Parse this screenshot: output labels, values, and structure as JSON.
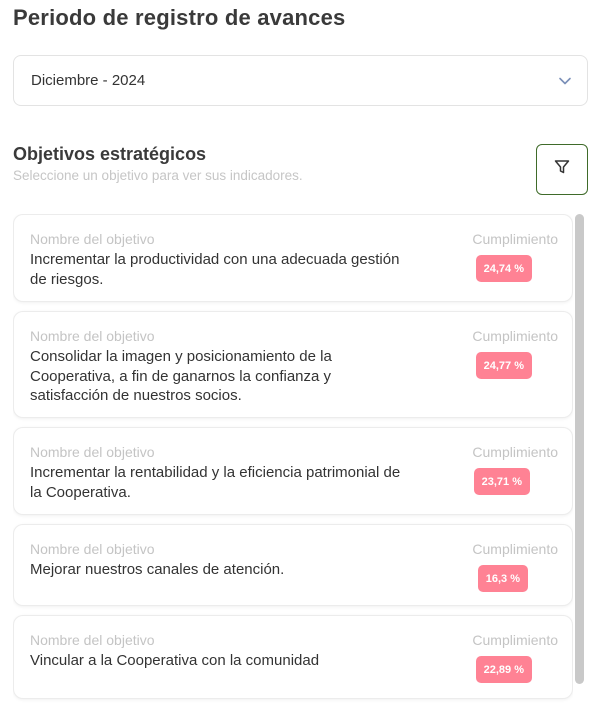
{
  "header": {
    "title": "Periodo de registro de avances"
  },
  "period_select": {
    "value": "Diciembre - 2024",
    "icon": "chevron-down-icon"
  },
  "objectives": {
    "title": "Objetivos estratégicos",
    "subtitle": "Seleccione un objetivo para ver sus indicadores.",
    "filter_icon": "filter-icon",
    "name_label": "Nombre del objetivo",
    "compliance_label": "Cumplimiento",
    "items": [
      {
        "name": "Incrementar la productividad con una adecuada gestión de riesgos.",
        "compliance": "24,74 %"
      },
      {
        "name": "Consolidar la imagen y posicionamiento de la Cooperativa, a fin de ganarnos la confianza y satisfacción de nuestros socios.",
        "compliance": "24,77 %"
      },
      {
        "name": "Incrementar la rentabilidad y la eficiencia patrimonial de la Cooperativa.",
        "compliance": "23,71 %"
      },
      {
        "name": "Mejorar nuestros canales de atención.",
        "compliance": "16,3 %"
      },
      {
        "name": "Vincular a la Cooperativa con la comunidad",
        "compliance": "22,89 %"
      }
    ]
  },
  "colors": {
    "badge": "#ff8294",
    "filter_border": "#3f6b2a",
    "chevron": "#7a8fb8"
  }
}
